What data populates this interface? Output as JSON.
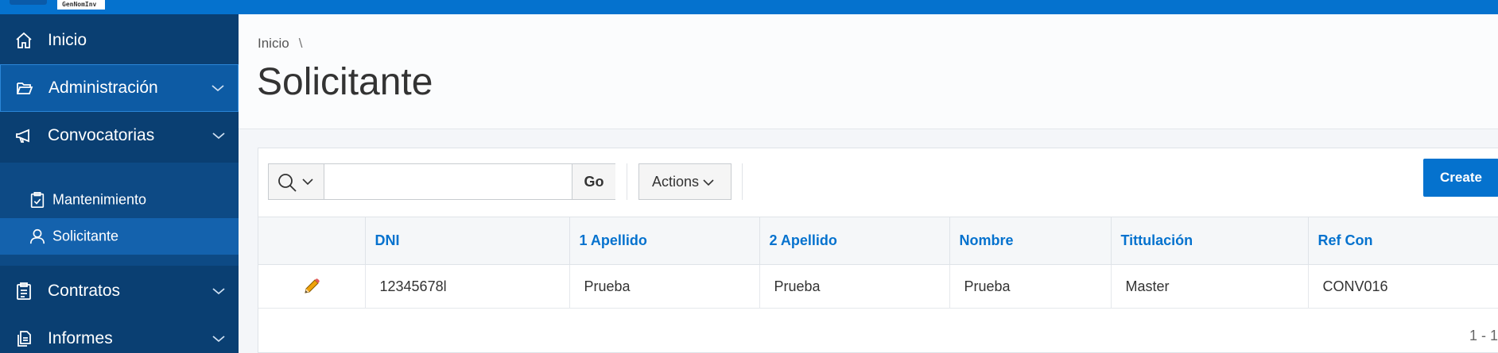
{
  "app": {
    "logo_text": "GenNomInv"
  },
  "sidebar": {
    "items": [
      {
        "label": "Inicio",
        "icon": "home-icon"
      },
      {
        "label": "Administración",
        "icon": "folder-open-icon"
      },
      {
        "label": "Convocatorias",
        "icon": "megaphone-icon"
      },
      {
        "label": "Contratos",
        "icon": "clipboard-icon"
      },
      {
        "label": "Informes",
        "icon": "report-copy-icon"
      }
    ],
    "sub_items": [
      {
        "label": "Mantenimiento",
        "icon": "clipboard-check-icon"
      },
      {
        "label": "Solicitante",
        "icon": "user-icon"
      }
    ]
  },
  "breadcrumb": {
    "home": "Inicio",
    "separator": "\\"
  },
  "page": {
    "title": "Solicitante"
  },
  "toolbar": {
    "search_value": "",
    "go_label": "Go",
    "actions_label": "Actions",
    "create_label": "Create"
  },
  "report": {
    "columns": [
      "DNI",
      "1 Apellido",
      "2 Apellido",
      "Nombre",
      "Tittulación",
      "Ref Con"
    ],
    "rows": [
      [
        "12345678l",
        "Prueba",
        "Prueba",
        "Prueba",
        "Master",
        "CONV016"
      ]
    ],
    "pagination": "1 - 1"
  },
  "colors": {
    "primary": "#0572ce",
    "sidebar_bg": "#0a3f72",
    "sidebar_active": "#0d5ba4",
    "edit_pencil": "#f0a30a"
  }
}
